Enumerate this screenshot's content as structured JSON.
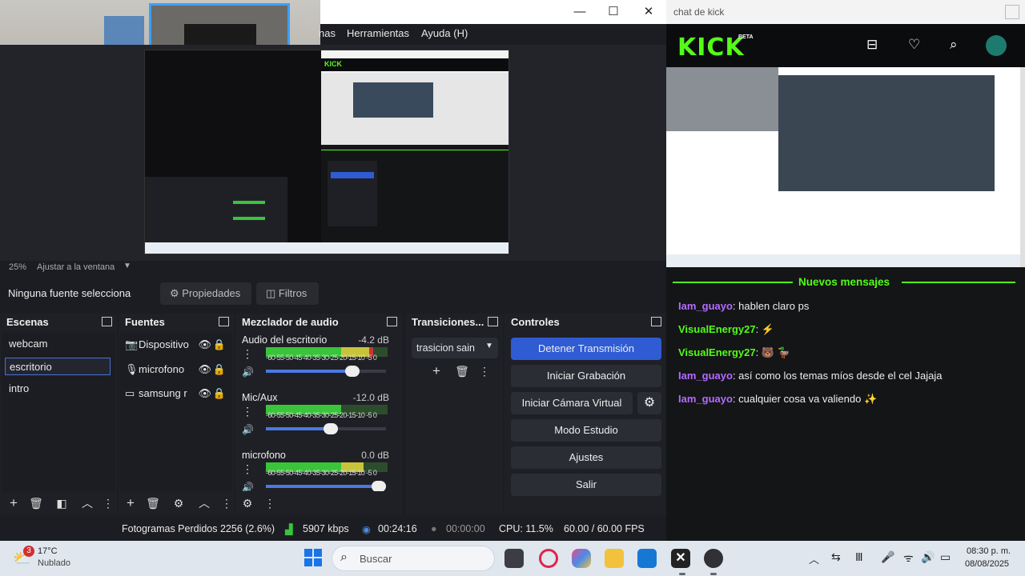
{
  "obs": {
    "menu": {
      "m1": "nas",
      "m2": "Herramientas",
      "m3": "Ayuda (H)"
    },
    "window": {
      "min": "—",
      "max": "☐",
      "close": "✕"
    },
    "zoom": {
      "percent": "25%",
      "mode": "Ajustar a la ventana"
    },
    "source_bar": {
      "selected": "Ninguna fuente selecciona",
      "properties": "Propiedades",
      "filters": "Filtros"
    },
    "scenes": {
      "title": "Escenas",
      "items": [
        "webcam",
        "escritorio",
        "intro"
      ]
    },
    "sources": {
      "title": "Fuentes",
      "items": [
        "Dispositivo",
        "microfono",
        "samsung r"
      ]
    },
    "mixer": {
      "title": "Mezclador de audio",
      "scale": "-60-55-50-45-40-35-30-25-20-15-10 -5 0",
      "channels": [
        {
          "name": "Audio del escritorio",
          "db": "-4.2 dB",
          "level": 0.88,
          "volume": 0.78
        },
        {
          "name": "Mic/Aux",
          "db": "-12.0 dB",
          "level": 0.62,
          "volume": 0.6
        },
        {
          "name": "microfono",
          "db": "0.0 dB",
          "level": 0.8,
          "volume": 1.0
        }
      ]
    },
    "transitions": {
      "title": "Transiciones...",
      "current": "trasicion sain"
    },
    "controls": {
      "title": "Controles",
      "stop_stream": "Detener Transmisión",
      "start_record": "Iniciar Grabación",
      "virtual_cam": "Iniciar Cámara Virtual",
      "studio": "Modo Estudio",
      "settings": "Ajustes",
      "exit": "Salir"
    },
    "status": {
      "dropped": "Fotogramas Perdidos 2256 (2.6%)",
      "bitrate": "5907 kbps",
      "stream_time": "00:24:16",
      "record_time": "00:00:00",
      "cpu": "CPU: 11.5%",
      "fps": "60.00 / 60.00 FPS"
    }
  },
  "kick": {
    "window_title": "chat de kick",
    "logo": "KICK",
    "beta": "BETA",
    "new_messages": "Nuevos mensajes",
    "messages": [
      {
        "user": "Iam_guayo",
        "text": ": hablen claro ps",
        "color": "#b46bff"
      },
      {
        "user": "VisualEnergy27",
        "text": ": ⚡",
        "color": "#53fc18"
      },
      {
        "user": "VisualEnergy27",
        "text": ":  🐻 🦆",
        "color": "#53fc18"
      },
      {
        "user": "Iam_guayo",
        "text": ": así como los temas míos desde el cel Jajaja",
        "color": "#b46bff"
      },
      {
        "user": "Iam_guayo",
        "text": ": cualquier cosa va valiendo ✨",
        "color": "#b46bff"
      }
    ]
  },
  "taskbar": {
    "weather_temp": "17°C",
    "weather_desc": "Nublado",
    "weather_badge": "3",
    "search": "Buscar",
    "time": "08:30 p. m.",
    "date": "08/08/2025"
  }
}
